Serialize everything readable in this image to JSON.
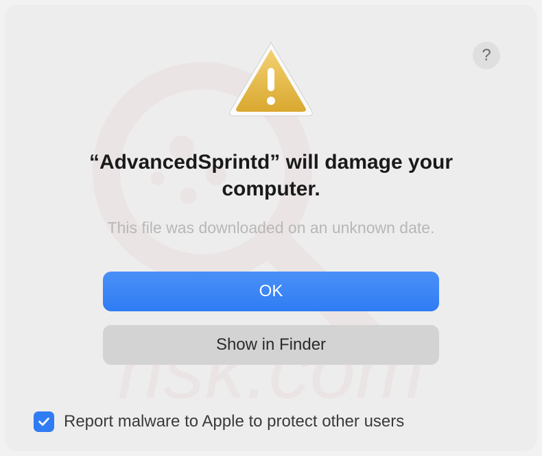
{
  "dialog": {
    "title": "“AdvancedSprintd” will damage your computer.",
    "subtitle": "This file was downloaded on an unknown date.",
    "primary_button": "OK",
    "secondary_button": "Show in Finder",
    "help_label": "?",
    "checkbox_label": "Report malware to Apple to protect other users",
    "checkbox_checked": true
  },
  "colors": {
    "primary_blue": "#2f7cf3",
    "background": "#eeeded",
    "secondary_button": "#d4d3d3"
  }
}
